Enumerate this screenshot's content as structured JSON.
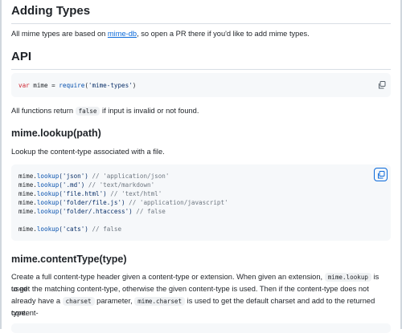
{
  "adding_types": {
    "heading": "Adding Types",
    "text_before": "All mime types are based on ",
    "link": "mime-db",
    "text_after": ", so open a PR there if you'd like to add mime types."
  },
  "api": {
    "heading": "API",
    "require_code": {
      "kw": "var",
      "name": " mime",
      "op": " = ",
      "fn": "require",
      "open": "(",
      "str": "'mime-types'",
      "close": ")"
    },
    "return_text_before": "All functions return ",
    "return_code": "false",
    "return_text_after": " if input is invalid or not found."
  },
  "lookup": {
    "heading": "mime.lookup(path)",
    "description": "Lookup the content-type associated with a file.",
    "lines": [
      {
        "obj": "mime.",
        "fn": "lookup",
        "arg": "('json')",
        "comment": " // 'application/json'"
      },
      {
        "obj": "mime.",
        "fn": "lookup",
        "arg": "('.md')",
        "comment": " // 'text/markdown'"
      },
      {
        "obj": "mime.",
        "fn": "lookup",
        "arg": "('file.html')",
        "comment": " // 'text/html'"
      },
      {
        "obj": "mime.",
        "fn": "lookup",
        "arg": "('folder/file.js')",
        "comment": " // 'application/javascript'"
      },
      {
        "obj": "mime.",
        "fn": "lookup",
        "arg": "('folder/.htaccess')",
        "comment": " // false"
      },
      {
        "obj": "mime.",
        "fn": "lookup",
        "arg": "('cats')",
        "comment": " // false"
      }
    ]
  },
  "content_type": {
    "heading": "mime.contentType(type)",
    "p1": "Create a full content-type header given a content-type or extension. When given an extension, ",
    "c1": "mime.lookup",
    "p2": " is used",
    "p3": "to get the matching content-type, otherwise the given content-type is used. Then if the content-type does not",
    "p4": "already have a ",
    "c2": "charset",
    "p5": " parameter, ",
    "c3": "mime.charset",
    "p6": " is used to get the default charset and add to the returned content-",
    "p7": "type."
  },
  "icons": {
    "copy": "copy-icon"
  },
  "colors": {
    "link": "#0969da",
    "keyword": "#cf222e",
    "function": "#0550ae",
    "string": "#0a3069",
    "comment": "#6e7781",
    "code_bg": "#f6f8fa"
  }
}
